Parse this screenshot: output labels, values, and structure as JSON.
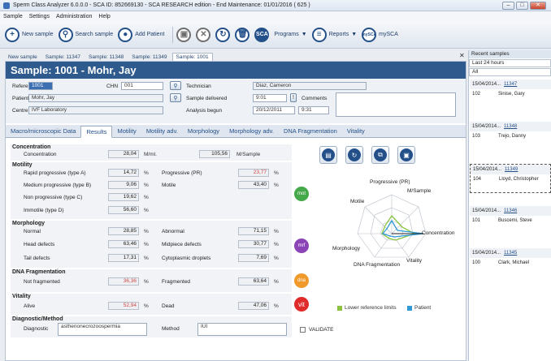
{
  "window": {
    "title": "Sperm Class Analyzer 6.0.0.0 - SCA ID: 852669130 - SCA RESEARCH edition - End Maintenance: 01/01/2016 ( 625 )"
  },
  "menu": [
    "Sample",
    "Settings",
    "Administration",
    "Help"
  ],
  "toolbar": {
    "new_sample": "New sample",
    "search_sample": "Search sample",
    "add_patient": "Add Patient",
    "sca": "SCA",
    "programs": "Programs",
    "reports": "Reports",
    "mysca": "mySCA",
    "mysca_icon": "mySCA"
  },
  "tabs": [
    "New sample",
    "Sample: 11347",
    "Sample: 11348",
    "Sample: 11349",
    "Sample: 1001"
  ],
  "sample_title": "Sample: 1001 - Mohr, Jay",
  "form": {
    "reference_label": "Reference",
    "reference": "1001",
    "chn_label": "CHN",
    "chn": "001",
    "technician_label": "Technician",
    "technician": "Diaz, Cameron",
    "patient_label": "Patient",
    "patient": "Mohr, Jay",
    "sample_delivered_label": "Sample delivered",
    "sample_delivered_time": "9:01",
    "comments_label": "Comments",
    "centre_label": "Centre",
    "centre": "IVF Laboratory",
    "analysis_begun_label": "Analysis begun",
    "analysis_date": "20/12/2011",
    "analysis_time": "9:31",
    "rating": 3.5
  },
  "subtabs": [
    "Macro/microscopic Data",
    "Results",
    "Motility",
    "Motility adv.",
    "Morphology",
    "Morphology adv.",
    "DNA Fragmentation",
    "Vitality"
  ],
  "results": {
    "concentration_head": "Concentration",
    "concentration_label": "Concentration",
    "concentration": "28,04",
    "concentration_unit": "M/ml.",
    "per_sample": "105,56",
    "per_sample_unit": "M/Sample",
    "motility_head": "Motility",
    "rapid_label": "Rapid progressive (type A)",
    "rapid": "14,72",
    "medium_label": "Medium progressive (type B)",
    "medium": "9,06",
    "nonprog_label": "Non progressive (type C)",
    "nonprog": "19,62",
    "immotile_label": "Immotile (type D)",
    "immotile": "56,60",
    "pr_label": "Progressive (PR)",
    "pr": "23,77",
    "motile_label": "Motile",
    "motile": "43,40",
    "morph_head": "Morphology",
    "normal_label": "Normal",
    "normal": "28,85",
    "head_label": "Head defects",
    "head": "63,46",
    "tail_label": "Tail defects",
    "tail": "17,31",
    "abnormal_label": "Abnormal",
    "abnormal": "71,15",
    "midpiece_label": "Midpiece defects",
    "midpiece": "30,77",
    "cyto_label": "Cytoplasmic droplets",
    "cyto": "7,69",
    "dna_head": "DNA Fragmentation",
    "notfrag_label": "Not fragmented",
    "notfrag": "36,36",
    "frag_label": "Fragmented",
    "frag": "63,64",
    "vit_head": "Vitality",
    "alive_label": "Alive",
    "alive": "52,94",
    "dead_label": "Dead",
    "dead": "47,06",
    "diag_head": "Diagnostic/Method",
    "diag_label": "Diagnostic",
    "diagnostic": "asthenonecrozoospermia",
    "method_label": "Method",
    "method": "IUI",
    "validate": "VALIDATE",
    "pct": "%",
    "badge_mot": "mot",
    "badge_mrf": "mrf",
    "badge_dna": "dna",
    "badge_vit": "vit"
  },
  "radar": {
    "labels": {
      "pr": "Progressive (PR)",
      "msample": "M/Sample",
      "motile": "Motile",
      "conc": "Concentration",
      "morph": "Morphology",
      "vit": "Vitality",
      "dna": "DNA Fragmentation"
    },
    "legend_lower": "Lower reference limits",
    "legend_patient": "Patient",
    "lower_color": "#8ac43f",
    "patient_color": "#2f9ad6"
  },
  "sidebar": {
    "title": "Recent samples",
    "range": "Last 24 hours",
    "filter": "All",
    "items": [
      {
        "date": "15/04/2014...",
        "sample": "11347",
        "id": "102",
        "name": "Sinise, Gary"
      },
      {
        "date": "15/04/2014...",
        "sample": "11348",
        "id": "103",
        "name": "Trejo, Danny"
      },
      {
        "date": "15/04/2014...",
        "sample": "11349",
        "id": "104",
        "name": "Lloyd, Christopher"
      },
      {
        "date": "15/04/2014...",
        "sample": "11346",
        "id": "101",
        "name": "Buscemi, Steve"
      },
      {
        "date": "15/04/2014...",
        "sample": "11345",
        "id": "100",
        "name": "Clark, Michael"
      }
    ]
  }
}
